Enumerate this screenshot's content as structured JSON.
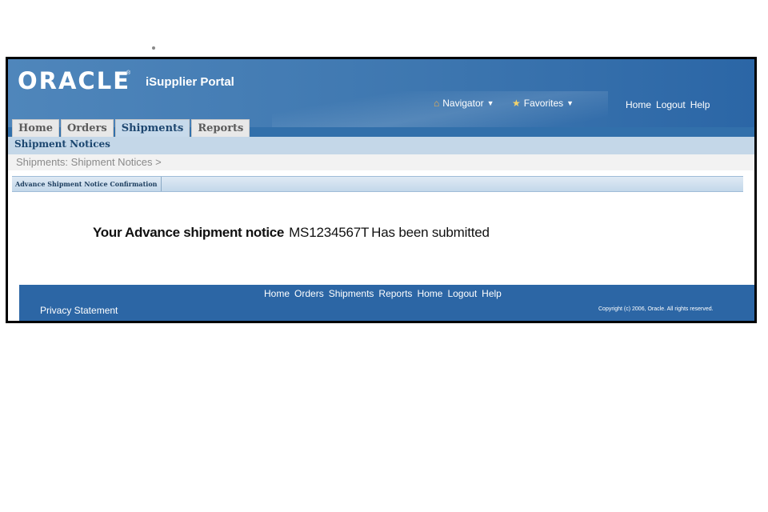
{
  "header": {
    "logo_text": "ORACLE",
    "logo_tm": "®",
    "product_name": "iSupplier Portal",
    "navigator_label": "Navigator",
    "favorites_label": "Favorites",
    "top_links": [
      "Home",
      "Logout",
      "Help"
    ]
  },
  "tabs": [
    {
      "label": "Home",
      "active": false
    },
    {
      "label": "Orders",
      "active": false
    },
    {
      "label": "Shipments",
      "active": true
    },
    {
      "label": "Reports",
      "active": false
    }
  ],
  "subtab": {
    "label": "Shipment Notices"
  },
  "breadcrumb": {
    "text": "Shipments: Shipment Notices  >"
  },
  "section": {
    "title": "Advance Shipment Notice Confirmation"
  },
  "confirmation": {
    "lead": "Your Advance shipment notice",
    "asn_number": "MS1234567T",
    "tail": "Has been submitted"
  },
  "footer": {
    "links": [
      "Home",
      "Orders",
      "Shipments",
      "Reports",
      "Home",
      "Logout",
      "Help"
    ],
    "privacy": "Privacy Statement",
    "copyright": "Copyright (c) 2006, Oracle. All rights reserved."
  },
  "colors": {
    "banner": "#3e77b0",
    "footer": "#2c66a5",
    "active_tab": "#c7daeb",
    "subtab_bar": "#c4d7e8"
  },
  "icons": {
    "navigator": "home-icon",
    "favorites": "favorites-icon"
  }
}
